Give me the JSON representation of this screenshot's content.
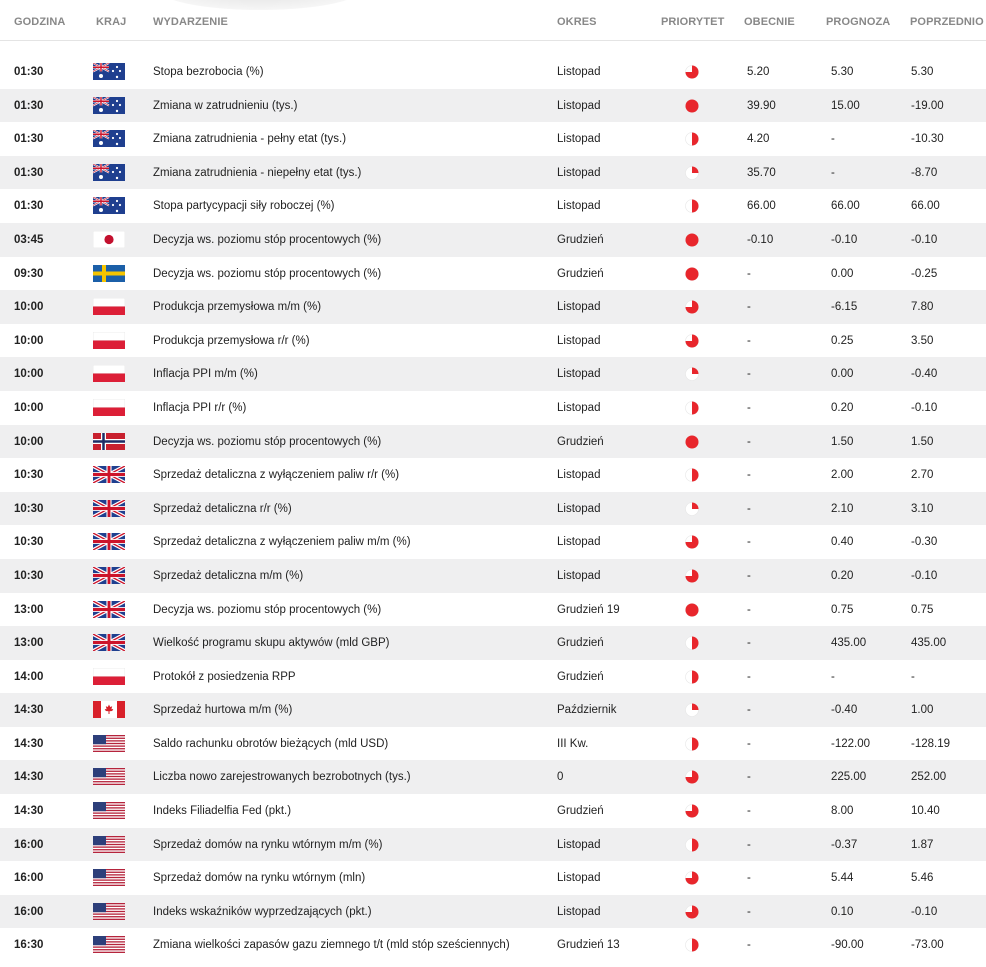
{
  "headers": {
    "time": "GODZINA",
    "country": "KRAJ",
    "event": "WYDARZENIE",
    "period": "OKRES",
    "priority": "PRIORYTET",
    "current": "OBECNIE",
    "forecast": "PROGNOZA",
    "previous": "POPRZEDNIO"
  },
  "colors": {
    "priority": "#e8262c",
    "row_alt": "#efeff0",
    "header_text": "#888888"
  },
  "rows": [
    {
      "time": "01:30",
      "flag": "au",
      "event": "Stopa bezrobocia (%)",
      "period": "Listopad",
      "priority": 0.75,
      "current": "5.20",
      "forecast": "5.30",
      "previous": "5.30"
    },
    {
      "time": "01:30",
      "flag": "au",
      "event": "Zmiana w zatrudnieniu (tys.)",
      "period": "Listopad",
      "priority": 1.0,
      "current": "39.90",
      "forecast": "15.00",
      "previous": "-19.00"
    },
    {
      "time": "01:30",
      "flag": "au",
      "event": "Zmiana zatrudnienia - pełny etat (tys.)",
      "period": "Listopad",
      "priority": 0.5,
      "current": "4.20",
      "forecast": "-",
      "previous": "-10.30"
    },
    {
      "time": "01:30",
      "flag": "au",
      "event": "Zmiana zatrudnienia - niepełny etat (tys.)",
      "period": "Listopad",
      "priority": 0.25,
      "current": "35.70",
      "forecast": "-",
      "previous": "-8.70"
    },
    {
      "time": "01:30",
      "flag": "au",
      "event": "Stopa partycypacji siły roboczej (%)",
      "period": "Listopad",
      "priority": 0.5,
      "current": "66.00",
      "forecast": "66.00",
      "previous": "66.00"
    },
    {
      "time": "03:45",
      "flag": "jp",
      "event": "Decyzja ws. poziomu stóp procentowych (%)",
      "period": "Grudzień",
      "priority": 1.0,
      "current": "-0.10",
      "forecast": "-0.10",
      "previous": "-0.10"
    },
    {
      "time": "09:30",
      "flag": "se",
      "event": "Decyzja ws. poziomu stóp procentowych (%)",
      "period": "Grudzień",
      "priority": 1.0,
      "current": "-",
      "forecast": "0.00",
      "previous": "-0.25"
    },
    {
      "time": "10:00",
      "flag": "pl",
      "event": "Produkcja przemysłowa m/m (%)",
      "period": "Listopad",
      "priority": 0.75,
      "current": "-",
      "forecast": "-6.15",
      "previous": "7.80"
    },
    {
      "time": "10:00",
      "flag": "pl",
      "event": "Produkcja przemysłowa r/r (%)",
      "period": "Listopad",
      "priority": 0.75,
      "current": "-",
      "forecast": "0.25",
      "previous": "3.50"
    },
    {
      "time": "10:00",
      "flag": "pl",
      "event": "Inflacja PPI m/m (%)",
      "period": "Listopad",
      "priority": 0.25,
      "current": "-",
      "forecast": "0.00",
      "previous": "-0.40"
    },
    {
      "time": "10:00",
      "flag": "pl",
      "event": "Inflacja PPI r/r (%)",
      "period": "Listopad",
      "priority": 0.5,
      "current": "-",
      "forecast": "0.20",
      "previous": "-0.10"
    },
    {
      "time": "10:00",
      "flag": "no",
      "event": "Decyzja ws. poziomu stóp procentowych (%)",
      "period": "Grudzień",
      "priority": 1.0,
      "current": "-",
      "forecast": "1.50",
      "previous": "1.50"
    },
    {
      "time": "10:30",
      "flag": "gb",
      "event": "Sprzedaż detaliczna z wyłączeniem paliw r/r (%)",
      "period": "Listopad",
      "priority": 0.5,
      "current": "-",
      "forecast": "2.00",
      "previous": "2.70"
    },
    {
      "time": "10:30",
      "flag": "gb",
      "event": "Sprzedaż detaliczna r/r (%)",
      "period": "Listopad",
      "priority": 0.25,
      "current": "-",
      "forecast": "2.10",
      "previous": "3.10"
    },
    {
      "time": "10:30",
      "flag": "gb",
      "event": "Sprzedaż detaliczna z wyłączeniem paliw m/m (%)",
      "period": "Listopad",
      "priority": 0.75,
      "current": "-",
      "forecast": "0.40",
      "previous": "-0.30"
    },
    {
      "time": "10:30",
      "flag": "gb",
      "event": "Sprzedaż detaliczna m/m (%)",
      "period": "Listopad",
      "priority": 0.75,
      "current": "-",
      "forecast": "0.20",
      "previous": "-0.10"
    },
    {
      "time": "13:00",
      "flag": "gb",
      "event": "Decyzja ws. poziomu stóp procentowych (%)",
      "period": "Grudzień 19",
      "priority": 1.0,
      "current": "-",
      "forecast": "0.75",
      "previous": "0.75"
    },
    {
      "time": "13:00",
      "flag": "gb",
      "event": "Wielkość programu skupu aktywów (mld GBP)",
      "period": "Grudzień",
      "priority": 0.5,
      "current": "-",
      "forecast": "435.00",
      "previous": "435.00"
    },
    {
      "time": "14:00",
      "flag": "pl",
      "event": "Protokół z posiedzenia RPP",
      "period": "Grudzień",
      "priority": 0.5,
      "current": "-",
      "forecast": "-",
      "previous": "-"
    },
    {
      "time": "14:30",
      "flag": "ca",
      "event": "Sprzedaż hurtowa m/m (%)",
      "period": "Październik",
      "priority": 0.25,
      "current": "-",
      "forecast": "-0.40",
      "previous": "1.00"
    },
    {
      "time": "14:30",
      "flag": "us",
      "event": "Saldo rachunku obrotów bieżących (mld USD)",
      "period": "III Kw.",
      "priority": 0.5,
      "current": "-",
      "forecast": "-122.00",
      "previous": "-128.19"
    },
    {
      "time": "14:30",
      "flag": "us",
      "event": "Liczba nowo zarejestrowanych bezrobotnych (tys.)",
      "period": "0",
      "priority": 0.75,
      "current": "-",
      "forecast": "225.00",
      "previous": "252.00"
    },
    {
      "time": "14:30",
      "flag": "us",
      "event": "Indeks Filiadelfia Fed (pkt.)",
      "period": "Grudzień",
      "priority": 0.75,
      "current": "-",
      "forecast": "8.00",
      "previous": "10.40"
    },
    {
      "time": "16:00",
      "flag": "us",
      "event": "Sprzedaż domów na rynku wtórnym m/m (%)",
      "period": "Listopad",
      "priority": 0.5,
      "current": "-",
      "forecast": "-0.37",
      "previous": "1.87"
    },
    {
      "time": "16:00",
      "flag": "us",
      "event": "Sprzedaż domów na rynku wtórnym (mln)",
      "period": "Listopad",
      "priority": 0.75,
      "current": "-",
      "forecast": "5.44",
      "previous": "5.46"
    },
    {
      "time": "16:00",
      "flag": "us",
      "event": "Indeks wskaźników wyprzedzających (pkt.)",
      "period": "Listopad",
      "priority": 0.75,
      "current": "-",
      "forecast": "0.10",
      "previous": "-0.10"
    },
    {
      "time": "16:30",
      "flag": "us",
      "event": "Zmiana wielkości zapasów gazu ziemnego t/t (mld stóp sześciennych)",
      "period": "Grudzień 13",
      "priority": 0.5,
      "current": "-",
      "forecast": "-90.00",
      "previous": "-73.00"
    }
  ]
}
